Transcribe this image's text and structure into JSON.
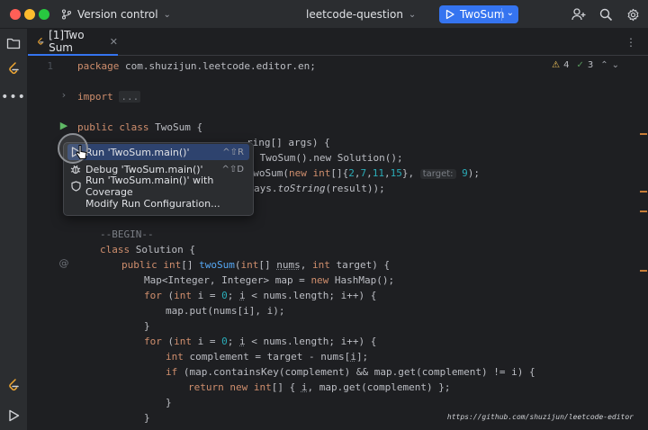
{
  "titlebar": {
    "version_control": "Version control",
    "project": "leetcode-question",
    "run_config": "TwoSum",
    "icons": [
      "add-user-icon",
      "search-icon",
      "settings-icon"
    ]
  },
  "tabs": [
    {
      "label": "[1]Two Sum",
      "active": true
    }
  ],
  "inspection": {
    "warnings": "4",
    "ok": "3"
  },
  "editor": {
    "line1_number": "1",
    "code": {
      "l1_kw": "package",
      "l1_rest": " com.shuzijun.leetcode.editor.en;",
      "import_kw": "import",
      "import_fold": "...",
      "class_public": "public",
      "class_class": "class",
      "class_name": " TwoSum {",
      "main_tail": "ring[] args) {",
      "sol_tail": " TwoSum().new Solution();",
      "call_pre": " twoSum(",
      "call_new": "new",
      "call_int": " int",
      "call_b1": "[]{",
      "n2": "2",
      "n7": "7",
      "n11": "11",
      "n15": "15",
      "call_b2": "}, ",
      "hint_target": "target:",
      "n9": "9",
      "call_end": ");",
      "print_tail": "ays.",
      "print_fn": "toString",
      "print_end": "(result));",
      "begin_comment": "--BEGIN--",
      "sol_class_kw": "class",
      "sol_class_rest": " Solution {",
      "m_public": "public",
      "m_int": " int",
      "m_ret": "[] ",
      "m_name": "twoSum",
      "m_params_open": "(",
      "m_int2": "int",
      "m_nums_pre": "[] ",
      "m_nums": "nums",
      "m_comma": ", ",
      "m_int3": "int",
      "m_target": " target) {",
      "map_decl": "Map<Integer, Integer> map = ",
      "map_new": "new",
      "map_rest": " HashMap();",
      "for1_kw": "for",
      "for_open": " (",
      "for_int": "int",
      "for_i": " i = ",
      "zero": "0",
      "for_cond_sep": "; ",
      "for_i2": "i",
      "for_cond": " < nums.length; i++) {",
      "put_line": "map.put(nums[i], i);",
      "close1": "}",
      "for2_kw": "for",
      "comp_int": "int",
      "comp_rest": " complement = target - nums[",
      "comp_i": "i",
      "comp_end": "];",
      "if_kw": "if",
      "if_rest": " (map.containsKey(complement) && map.get(complement) != i) {",
      "ret_kw": "return",
      "ret_new": " new",
      "ret_int": " int",
      "ret_rest1": "[] { ",
      "ret_i": "i",
      "ret_rest2": ", map.get(complement) };",
      "close2": "}",
      "close3": "}"
    }
  },
  "context_menu": {
    "items": [
      {
        "label": "Run 'TwoSum.main()'",
        "shortcut": "^⇧R",
        "icon": "run-icon",
        "selected": true
      },
      {
        "label": "Debug 'TwoSum.main()'",
        "shortcut": "^⇧D",
        "icon": "debug-icon",
        "selected": false
      },
      {
        "label": "Run 'TwoSum.main()' with Coverage",
        "shortcut": "",
        "icon": "coverage-icon",
        "selected": false
      },
      {
        "label": "Modify Run Configuration...",
        "shortcut": "",
        "icon": "",
        "selected": false
      }
    ]
  },
  "footer": {
    "url": "https://github.com/shuzijun/leetcode-editor"
  }
}
